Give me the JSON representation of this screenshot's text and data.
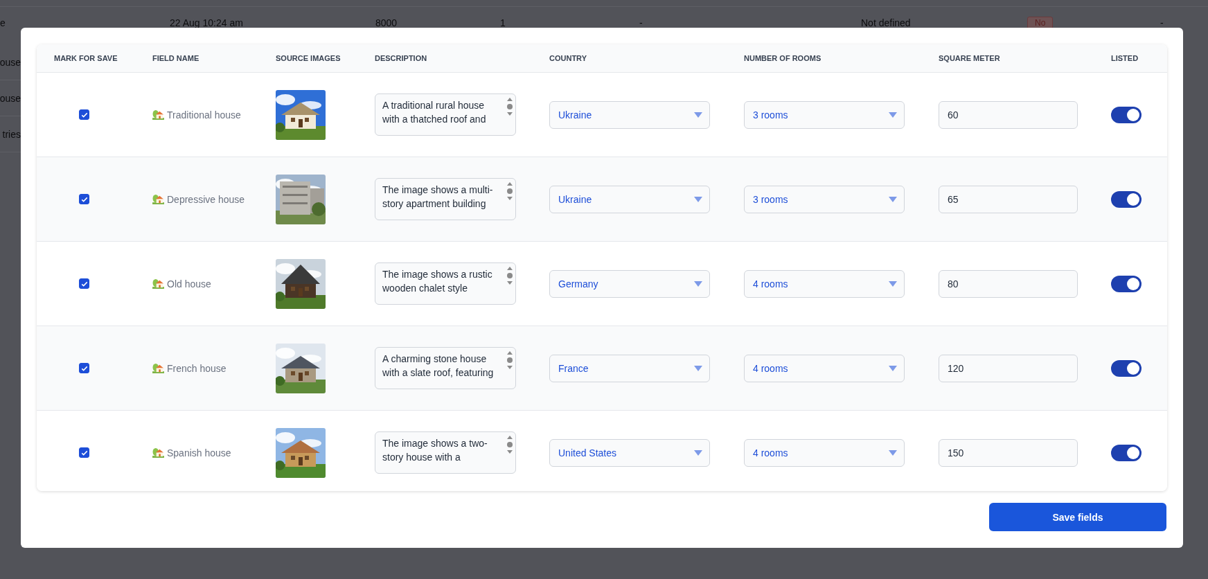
{
  "background": {
    "row": [
      {
        "kind": "text",
        "text": "e"
      },
      {
        "kind": "text",
        "text": "22 Aug 10:24 am"
      },
      {
        "kind": "text",
        "text": "8000"
      },
      {
        "kind": "text",
        "text": "1"
      },
      {
        "kind": "text",
        "text": "-"
      },
      {
        "kind": "text",
        "text": "Not defined"
      },
      {
        "kind": "badge",
        "text": "No"
      },
      {
        "kind": "text",
        "text": "-"
      }
    ],
    "side_texts": [
      "ouse",
      "ouse",
      "tries"
    ]
  },
  "table": {
    "columns": [
      "MARK FOR SAVE",
      "FIELD NAME",
      "SOURCE IMAGES",
      "DESCRIPTION",
      "COUNTRY",
      "NUMBER OF ROOMS",
      "SQUARE METER",
      "LISTED"
    ],
    "rows": [
      {
        "mark_for_save": true,
        "field_name": "Traditional house",
        "description": "A traditional rural house with a thatched roof and",
        "country": "Ukraine",
        "rooms": "3 rooms",
        "square_meter": "60",
        "listed": true
      },
      {
        "mark_for_save": true,
        "field_name": "Depressive house",
        "description": "The image shows a multi-story apartment building",
        "country": "Ukraine",
        "rooms": "3 rooms",
        "square_meter": "65",
        "listed": true
      },
      {
        "mark_for_save": true,
        "field_name": "Old house",
        "description": "The image shows a rustic wooden chalet style",
        "country": "Germany",
        "rooms": "4 rooms",
        "square_meter": "80",
        "listed": true
      },
      {
        "mark_for_save": true,
        "field_name": "French house",
        "description": "A charming stone house with a slate roof, featuring",
        "country": "France",
        "rooms": "4 rooms",
        "square_meter": "120",
        "listed": true
      },
      {
        "mark_for_save": true,
        "field_name": "Spanish house",
        "description": "The image shows a two-story house with a",
        "country": "United States",
        "rooms": "4 rooms",
        "square_meter": "150",
        "listed": true
      }
    ]
  },
  "save_button": "Save fields"
}
